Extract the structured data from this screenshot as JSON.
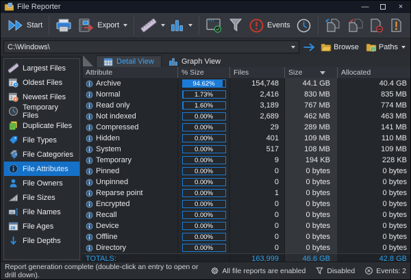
{
  "window": {
    "title": "File Reporter"
  },
  "toolbar": {
    "start": "Start",
    "export": "Export",
    "events": "Events"
  },
  "addressbar": {
    "path": "C:\\Windows\\",
    "browse": "Browse",
    "paths": "Paths"
  },
  "sidebar": {
    "items": [
      {
        "label": "Largest Files",
        "icon": "ruler-icon",
        "selected": false
      },
      {
        "label": "Oldest Files",
        "icon": "calendar-old-icon",
        "selected": false
      },
      {
        "label": "Newest Files",
        "icon": "calendar-new-icon",
        "selected": false
      },
      {
        "label": "Temporary Files",
        "icon": "clock-icon",
        "selected": false
      },
      {
        "label": "Duplicate Files",
        "icon": "duplicate-files-icon",
        "selected": false
      },
      {
        "label": "File Types",
        "icon": "tag-icon",
        "selected": false
      },
      {
        "label": "File Categories",
        "icon": "tags-icon",
        "selected": false
      },
      {
        "label": "File Attributes",
        "icon": "info-icon",
        "selected": true
      },
      {
        "label": "File Owners",
        "icon": "user-icon",
        "selected": false
      },
      {
        "label": "File Sizes",
        "icon": "ramp-icon",
        "selected": false
      },
      {
        "label": "File Names",
        "icon": "rename-icon",
        "selected": false
      },
      {
        "label": "File Ages",
        "icon": "calendar-ages-icon",
        "selected": false
      },
      {
        "label": "File Depths",
        "icon": "arrow-down-icon",
        "selected": false
      }
    ]
  },
  "tabs": [
    {
      "label": "Detail View",
      "active": true
    },
    {
      "label": "Graph View",
      "active": false
    }
  ],
  "table": {
    "columns": {
      "attribute": "Attribute",
      "percent": "% Size",
      "files": "Files",
      "size": "Size",
      "allocated": "Allocated"
    },
    "sorted_by": "Size",
    "rows": [
      {
        "attribute": "Archive",
        "percent": "94.62%",
        "percent_value": 94.62,
        "files": "154,748",
        "size": "44.1 GB",
        "allocated": "40.4 GB"
      },
      {
        "attribute": "Normal",
        "percent": "1.73%",
        "percent_value": 1.73,
        "files": "2,416",
        "size": "830 MB",
        "allocated": "835 MB"
      },
      {
        "attribute": "Read only",
        "percent": "1.60%",
        "percent_value": 1.6,
        "files": "3,189",
        "size": "767 MB",
        "allocated": "774 MB"
      },
      {
        "attribute": "Not indexed",
        "percent": "0.00%",
        "percent_value": 0,
        "files": "2,689",
        "size": "462 MB",
        "allocated": "463 MB"
      },
      {
        "attribute": "Compressed",
        "percent": "0.00%",
        "percent_value": 0,
        "files": "29",
        "size": "289 MB",
        "allocated": "141 MB"
      },
      {
        "attribute": "Hidden",
        "percent": "0.00%",
        "percent_value": 0,
        "files": "401",
        "size": "109 MB",
        "allocated": "110 MB"
      },
      {
        "attribute": "System",
        "percent": "0.00%",
        "percent_value": 0,
        "files": "517",
        "size": "108 MB",
        "allocated": "109 MB"
      },
      {
        "attribute": "Temporary",
        "percent": "0.00%",
        "percent_value": 0,
        "files": "9",
        "size": "194 KB",
        "allocated": "228 KB"
      },
      {
        "attribute": "Pinned",
        "percent": "0.00%",
        "percent_value": 0,
        "files": "0",
        "size": "0 bytes",
        "allocated": "0 bytes"
      },
      {
        "attribute": "Unpinned",
        "percent": "0.00%",
        "percent_value": 0,
        "files": "0",
        "size": "0 bytes",
        "allocated": "0 bytes"
      },
      {
        "attribute": "Reparse point",
        "percent": "0.00%",
        "percent_value": 0,
        "files": "1",
        "size": "0 bytes",
        "allocated": "0 bytes"
      },
      {
        "attribute": "Encrypted",
        "percent": "0.00%",
        "percent_value": 0,
        "files": "0",
        "size": "0 bytes",
        "allocated": "0 bytes"
      },
      {
        "attribute": "Recall",
        "percent": "0.00%",
        "percent_value": 0,
        "files": "0",
        "size": "0 bytes",
        "allocated": "0 bytes"
      },
      {
        "attribute": "Device",
        "percent": "0.00%",
        "percent_value": 0,
        "files": "0",
        "size": "0 bytes",
        "allocated": "0 bytes"
      },
      {
        "attribute": "Offline",
        "percent": "0.00%",
        "percent_value": 0,
        "files": "0",
        "size": "0 bytes",
        "allocated": "0 bytes"
      },
      {
        "attribute": "Directory",
        "percent": "0.00%",
        "percent_value": 0,
        "files": "0",
        "size": "0 bytes",
        "allocated": "0 bytes"
      }
    ],
    "totals": {
      "label": "TOTALS:",
      "files": "163,999",
      "size": "46.6 GB",
      "allocated": "42.8 GB"
    }
  },
  "statusbar": {
    "message": "Report generation complete (double-click an entry to open or drill down).",
    "reports": "All file reports are enabled",
    "filter": "Disabled",
    "events": "Events: 2"
  },
  "colors": {
    "accent_blue": "#2f8fe0",
    "selection_blue": "#1571c8",
    "bar_blue": "#1b7bd6",
    "totals_blue": "#2d9fe8",
    "event_red": "#c0392b"
  }
}
